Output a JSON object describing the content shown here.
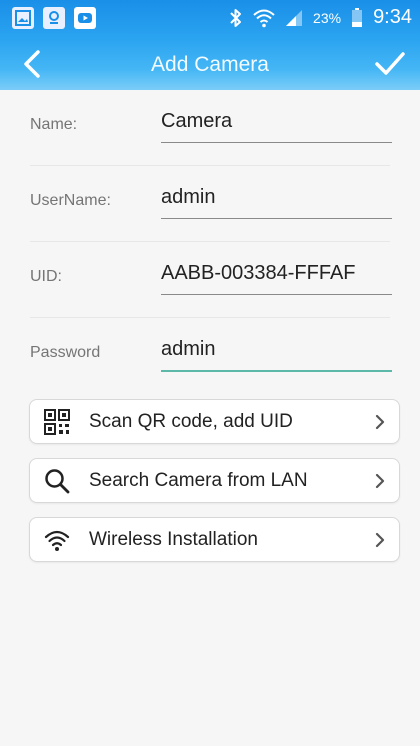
{
  "status_bar": {
    "icons": [
      "gallery-icon",
      "maps-icon",
      "youtube-icon",
      "bluetooth-icon",
      "wifi-icon",
      "signal-icon",
      "battery-icon"
    ],
    "battery_percent": "23%",
    "time": "9:34"
  },
  "header": {
    "title": "Add Camera",
    "back_icon": "chevron-left-icon",
    "confirm_icon": "check-icon",
    "accent_color": "#2aa3f0"
  },
  "form": {
    "name": {
      "label": "Name:",
      "value": "Camera"
    },
    "username": {
      "label": "UserName:",
      "value": "admin"
    },
    "uid": {
      "label": "UID:",
      "value": "AABB-003384-FFFAF"
    },
    "password": {
      "label": "Password",
      "value": "admin"
    }
  },
  "actions": {
    "scan_qr": {
      "label": "Scan QR code, add UID",
      "icon": "qr-code-icon"
    },
    "search_lan": {
      "label": "Search Camera from LAN",
      "icon": "search-icon"
    },
    "wireless": {
      "label": "Wireless Installation",
      "icon": "wifi-icon"
    }
  }
}
